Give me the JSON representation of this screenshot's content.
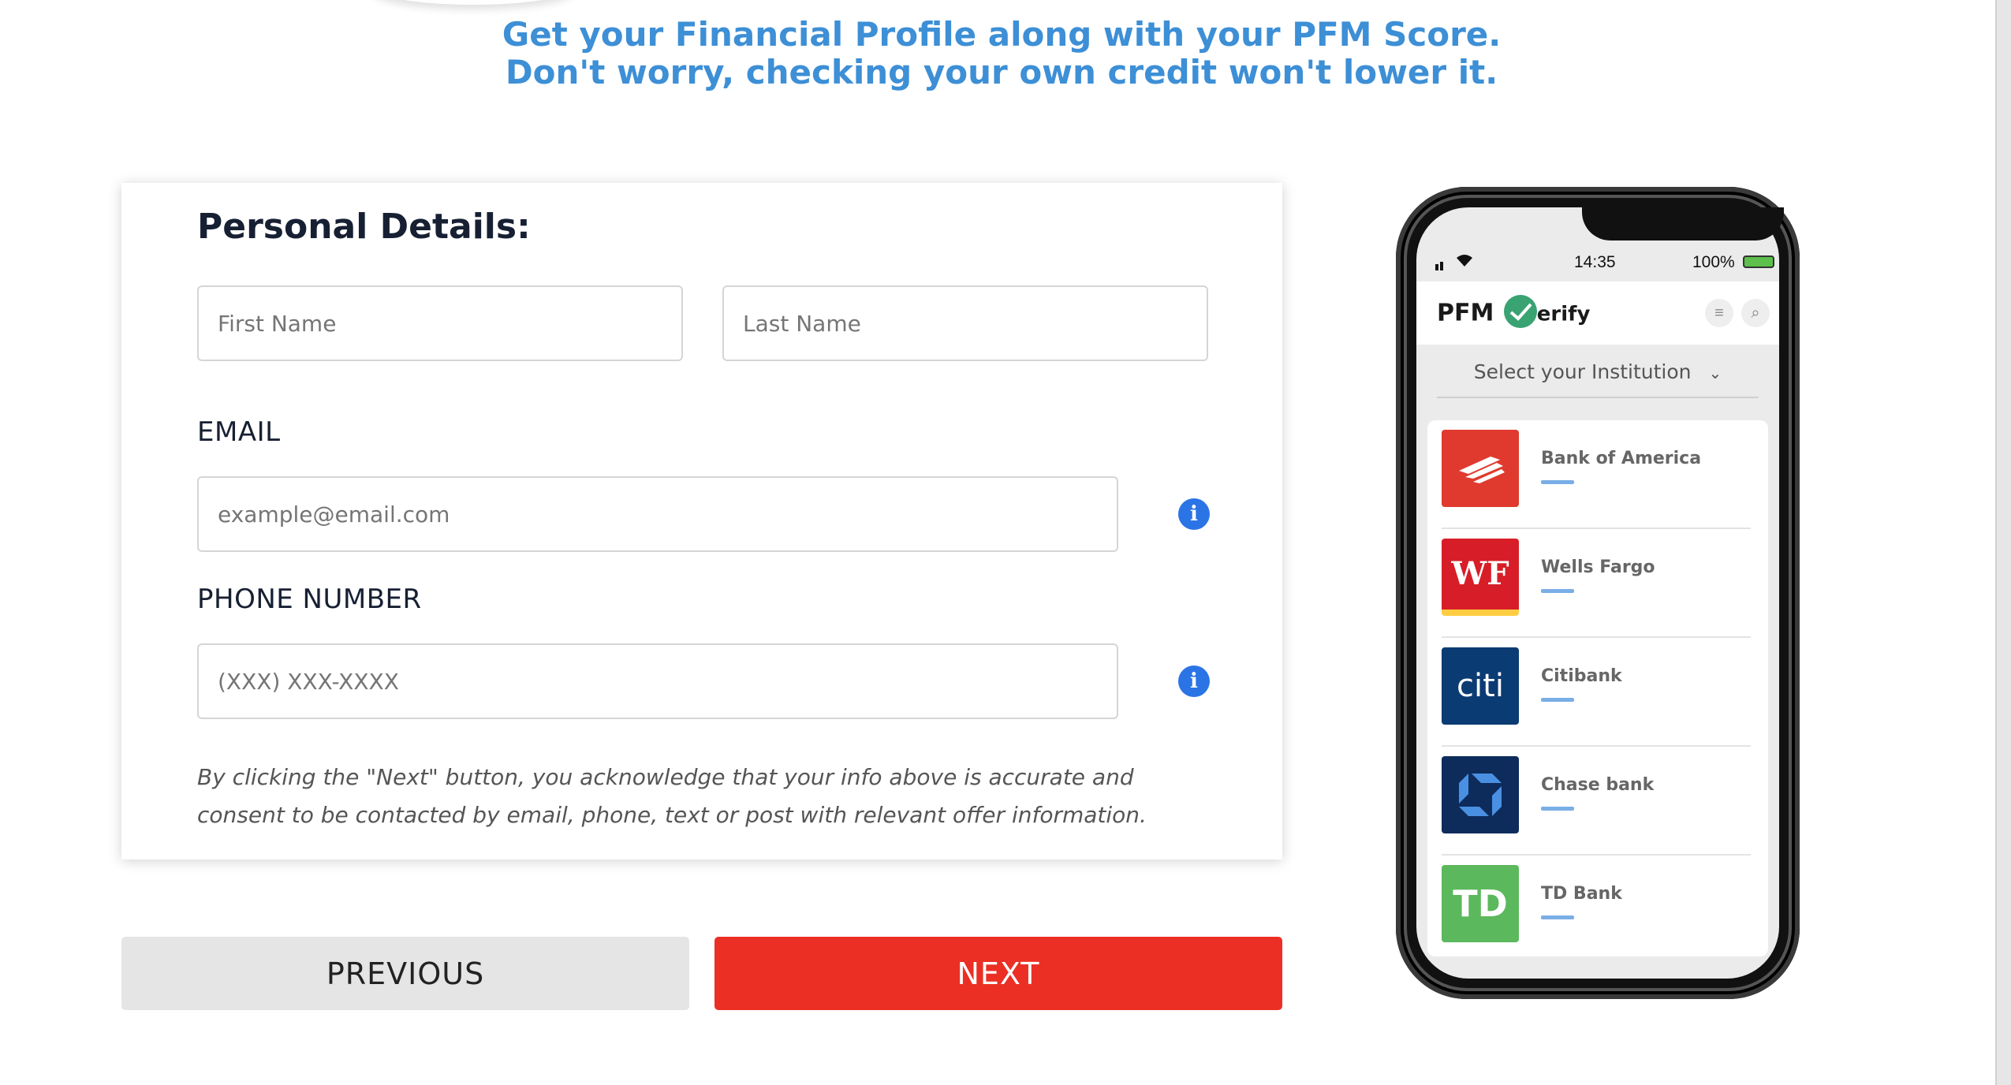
{
  "headline": {
    "line1": "Get your Financial Profile along with your PFM Score.",
    "line2": "Don't worry, checking your own credit won't lower it."
  },
  "form": {
    "title": "Personal Details:",
    "first_name_placeholder": "First Name",
    "last_name_placeholder": "Last Name",
    "email_label": "EMAIL",
    "email_placeholder": "example@email.com",
    "phone_label": "PHONE NUMBER",
    "phone_placeholder": "(XXX) XXX-XXXX",
    "info_icon": "i",
    "consent": "By clicking the \"Next\" button, you acknowledge that your info above is accurate and consent to be contacted by email, phone, text or post with relevant offer information."
  },
  "buttons": {
    "previous": "PREVIOUS",
    "next": "NEXT"
  },
  "phone": {
    "time": "14:35",
    "battery": "100%",
    "logo_prefix": "PFM",
    "logo_suffix": "erify",
    "select_label": "Select your Institution",
    "banks": [
      {
        "name": "Bank of America",
        "logo_text": "",
        "color": "#e03a2e"
      },
      {
        "name": "Wells Fargo",
        "logo_text": "WF",
        "color": "#d71e28"
      },
      {
        "name": "Citibank",
        "logo_text": "citi",
        "color": "#0b3b73"
      },
      {
        "name": "Chase bank",
        "logo_text": "",
        "color": "#0d2c5c"
      },
      {
        "name": "TD Bank",
        "logo_text": "TD",
        "color": "#5cb85c"
      }
    ]
  },
  "colors": {
    "headline": "#3d8fd6",
    "next_button": "#eb2f24",
    "previous_button": "#e5e5e5",
    "info_icon": "#2b74e6"
  }
}
